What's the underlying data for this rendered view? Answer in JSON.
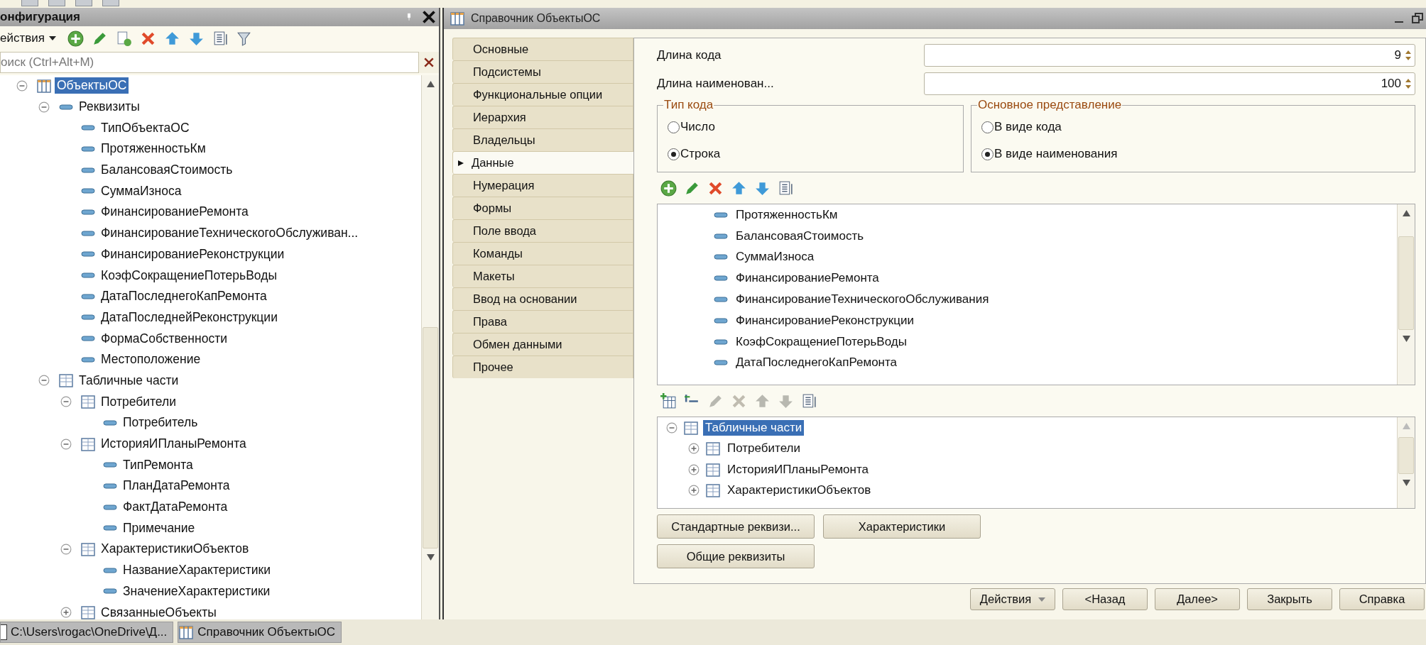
{
  "config_panel": {
    "title": "онфигурация",
    "actions_label": "ействия",
    "search": {
      "placeholder": "оиск (Ctrl+Alt+M)"
    },
    "tree": [
      {
        "label": "ОбъектыОС",
        "kind": "catalog",
        "expanded": true,
        "selected": true,
        "children": [
          {
            "label": "Реквизиты",
            "kind": "attribute",
            "expanded": true,
            "selected": false,
            "children": [
              {
                "label": "ТипОбъектаОС",
                "kind": "attribute",
                "selected": false
              },
              {
                "label": "ПротяженностьКм",
                "kind": "attribute",
                "selected": false
              },
              {
                "label": "БалансоваяСтоимость",
                "kind": "attribute",
                "selected": false
              },
              {
                "label": "СуммаИзноса",
                "kind": "attribute",
                "selected": false
              },
              {
                "label": "ФинансированиеРемонта",
                "kind": "attribute",
                "selected": false
              },
              {
                "label": "ФинансированиеТехническогоОбслуживан...",
                "kind": "attribute",
                "selected": false
              },
              {
                "label": "ФинансированиеРеконструкции",
                "kind": "attribute",
                "selected": false
              },
              {
                "label": "КоэфСокращениеПотерьВоды",
                "kind": "attribute",
                "selected": false
              },
              {
                "label": "ДатаПоследнегоКапРемонта",
                "kind": "attribute",
                "selected": false
              },
              {
                "label": "ДатаПоследнейРеконструкции",
                "kind": "attribute",
                "selected": false
              },
              {
                "label": "ФормаСобственности",
                "kind": "attribute",
                "selected": false
              },
              {
                "label": "Местоположение",
                "kind": "attribute",
                "selected": false
              }
            ]
          },
          {
            "label": "Табличные части",
            "kind": "table",
            "expanded": true,
            "selected": false,
            "children": [
              {
                "label": "Потребители",
                "kind": "table",
                "expanded": true,
                "selected": false,
                "children": [
                  {
                    "label": "Потребитель",
                    "kind": "attribute",
                    "selected": false
                  }
                ]
              },
              {
                "label": "ИсторияИПланыРемонта",
                "kind": "table",
                "expanded": true,
                "selected": false,
                "children": [
                  {
                    "label": "ТипРемонта",
                    "kind": "attribute",
                    "selected": false
                  },
                  {
                    "label": "ПланДатаРемонта",
                    "kind": "attribute",
                    "selected": false
                  },
                  {
                    "label": "ФактДатаРемонта",
                    "kind": "attribute",
                    "selected": false
                  },
                  {
                    "label": "Примечание",
                    "kind": "attribute",
                    "selected": false
                  }
                ]
              },
              {
                "label": "ХарактеристикиОбъектов",
                "kind": "table",
                "expanded": true,
                "selected": false,
                "children": [
                  {
                    "label": "НазваниеХарактеристики",
                    "kind": "attribute",
                    "selected": false
                  },
                  {
                    "label": "ЗначениеХарактеристики",
                    "kind": "attribute",
                    "selected": false
                  }
                ]
              },
              {
                "label": "СвязанныеОбъекты",
                "kind": "table",
                "expanded": false,
                "selected": false
              }
            ]
          }
        ]
      }
    ]
  },
  "window": {
    "title": "Справочник ОбъектыОС",
    "tabs": [
      {
        "label": "Основные",
        "selected": false
      },
      {
        "label": "Подсистемы",
        "selected": false
      },
      {
        "label": "Функциональные опции",
        "selected": false
      },
      {
        "label": "Иерархия",
        "selected": false
      },
      {
        "label": "Владельцы",
        "selected": false
      },
      {
        "label": "Данные",
        "selected": true
      },
      {
        "label": "Нумерация",
        "selected": false
      },
      {
        "label": "Формы",
        "selected": false
      },
      {
        "label": "Поле ввода",
        "selected": false
      },
      {
        "label": "Команды",
        "selected": false
      },
      {
        "label": "Макеты",
        "selected": false
      },
      {
        "label": "Ввод на основании",
        "selected": false
      },
      {
        "label": "Права",
        "selected": false
      },
      {
        "label": "Обмен данными",
        "selected": false
      },
      {
        "label": "Прочее",
        "selected": false
      }
    ],
    "fields": [
      {
        "label": "Длина кода",
        "value": "9"
      },
      {
        "label": "Длина наименован...",
        "value": "100"
      }
    ],
    "groups": [
      {
        "title": "Тип кода",
        "options": [
          {
            "label": "Число",
            "selected": false
          },
          {
            "label": "Строка",
            "selected": true
          }
        ]
      },
      {
        "title": "Основное представление",
        "options": [
          {
            "label": "В виде кода",
            "selected": false
          },
          {
            "label": "В виде наименования",
            "selected": true
          }
        ]
      }
    ],
    "attributes": [
      "ПротяженностьКм",
      "БалансоваяСтоимость",
      "СуммаИзноса",
      "ФинансированиеРемонта",
      "ФинансированиеТехническогоОбслуживания",
      "ФинансированиеРеконструкции",
      "КоэфСокращениеПотерьВоды",
      "ДатаПоследнегоКапРемонта"
    ],
    "table_parts": [
      {
        "label": "Табличные части",
        "expanded": true,
        "selected": true,
        "children": [
          {
            "label": "Потребители",
            "expanded": false,
            "selected": false
          },
          {
            "label": "ИсторияИПланыРемонта",
            "expanded": false,
            "selected": false
          },
          {
            "label": "ХарактеристикиОбъектов",
            "expanded": false,
            "selected": false
          }
        ]
      }
    ],
    "panel_buttons": [
      "Стандартные реквизи...",
      "Характеристики",
      "Общие реквизиты"
    ],
    "footer_buttons": [
      {
        "label": "Действия",
        "kind": "dropdown"
      },
      {
        "label": "<Назад",
        "kind": "button"
      },
      {
        "label": "Далее>",
        "kind": "button"
      },
      {
        "label": "Закрыть",
        "kind": "button"
      },
      {
        "label": "Справка",
        "kind": "button"
      }
    ]
  },
  "taskbar": [
    "C:\\Users\\rogac\\OneDrive\\Д...",
    "Справочник ОбъектыОС"
  ]
}
